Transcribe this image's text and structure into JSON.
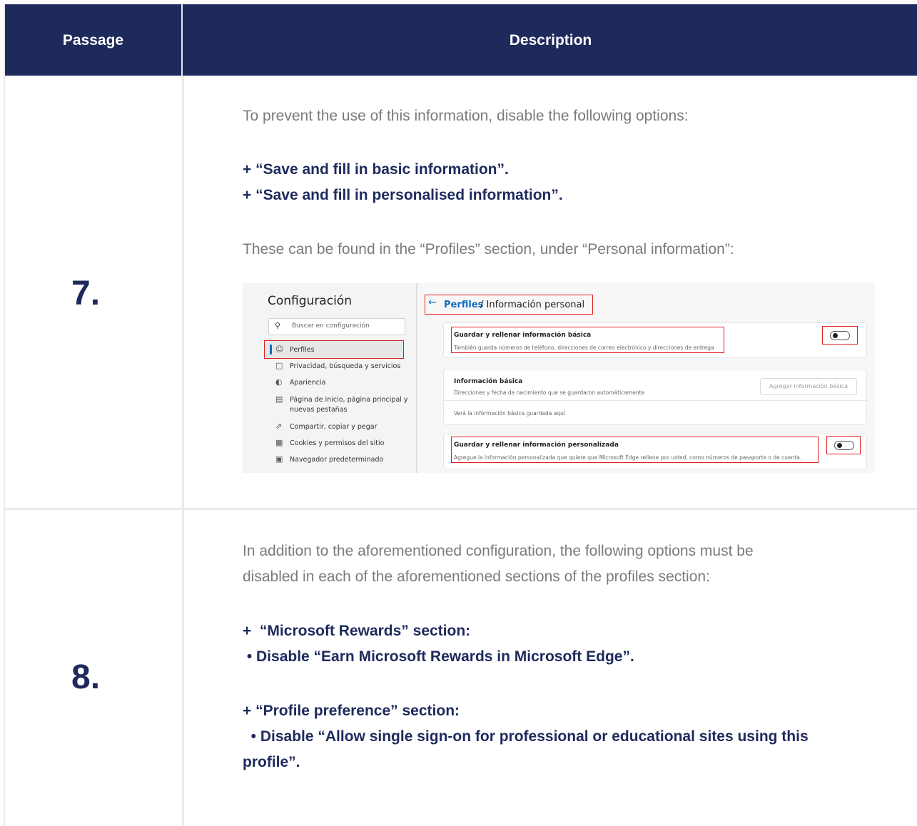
{
  "header": {
    "passage": "Passage",
    "description": "Description"
  },
  "row7": {
    "number": "7.",
    "intro": "To prevent the use of this information, disable the following options:",
    "options": [
      "+ “Save and fill in basic information”.",
      "+ “Save and fill in personalised information”."
    ],
    "location": "These can be found in the “Profiles” section, under “Personal information”:",
    "screenshot": {
      "settings_title": "Configuración",
      "search_placeholder": "Buscar en configuración",
      "nav": [
        {
          "icon": "profile-icon",
          "label": "Perfiles"
        },
        {
          "icon": "lock-icon",
          "label": "Privacidad, búsqueda y servicios"
        },
        {
          "icon": "appearance-icon",
          "label": "Apariencia"
        },
        {
          "icon": "home-page-icon",
          "label": "Página de inicio, página principal y"
        },
        {
          "icon": "",
          "label": "nuevas pestañas"
        },
        {
          "icon": "share-icon",
          "label": "Compartir, copiar y pegar"
        },
        {
          "icon": "cookies-icon",
          "label": "Cookies y permisos del sitio"
        },
        {
          "icon": "browser-icon",
          "label": "Navegador predeterminado"
        }
      ],
      "breadcrumb_link": "Perfiles",
      "breadcrumb_rest": "/ Información personal",
      "card1_title": "Guardar y rellenar información básica",
      "card1_sub": "También guarda números de teléfono, direcciones de correo electrónico y direcciones de entrega",
      "card2_title": "Información básica",
      "card2_sub": "Direcciones y fecha de nacimiento que se guardaron automáticamente",
      "card2_button": "Agregar información básica",
      "card2_note": "Verá la información básica guardada aquí",
      "card3_title": "Guardar y rellenar información personalizada",
      "card3_sub": "Agregue la información personalizada que quiere que Microsoft Edge rellene por usted, como números de pasaporte o de cuenta."
    }
  },
  "row8": {
    "number": "8.",
    "intro_line1": "In addition to the aforementioned configuration, the following options must be",
    "intro_line2": "disabled in each of the aforementioned sections of the profiles section:",
    "rewards_heading": "+  “Microsoft Rewards” section:",
    "rewards_item": " • Disable “Earn Microsoft Rewards in Microsoft Edge”.",
    "pref_heading": "+ “Profile preference” section:",
    "pref_item_line1": "  • Disable “Allow single sign-on for professional or educational sites using this",
    "pref_item_line2": "profile”."
  }
}
